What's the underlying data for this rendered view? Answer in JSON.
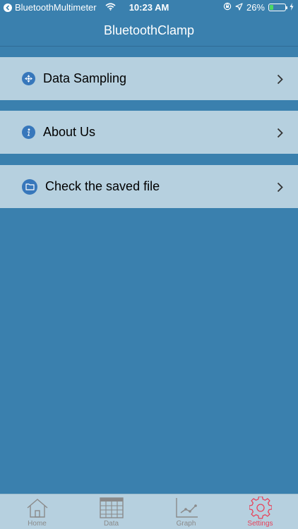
{
  "status_bar": {
    "back_app": "BluetoothMultimeter",
    "time": "10:23 AM",
    "battery": "26%",
    "battery_level": 0.26
  },
  "nav": {
    "title": "BluetoothClamp"
  },
  "menu": {
    "items": [
      {
        "label": "Data Sampling",
        "icon": "sampling-icon"
      },
      {
        "label": "About Us",
        "icon": "info-icon"
      },
      {
        "label": "Check the saved file",
        "icon": "folder-icon"
      }
    ]
  },
  "tabs": {
    "items": [
      {
        "label": "Home",
        "icon": "home-icon",
        "active": false
      },
      {
        "label": "Data",
        "icon": "table-icon",
        "active": false
      },
      {
        "label": "Graph",
        "icon": "graph-icon",
        "active": false
      },
      {
        "label": "Settings",
        "icon": "gear-icon",
        "active": true
      }
    ]
  },
  "colors": {
    "background": "#3a80ae",
    "row_background": "#b6d0df",
    "icon_blue": "#3777bb",
    "tab_active": "#e8425a",
    "tab_inactive": "#8a8a8a"
  }
}
